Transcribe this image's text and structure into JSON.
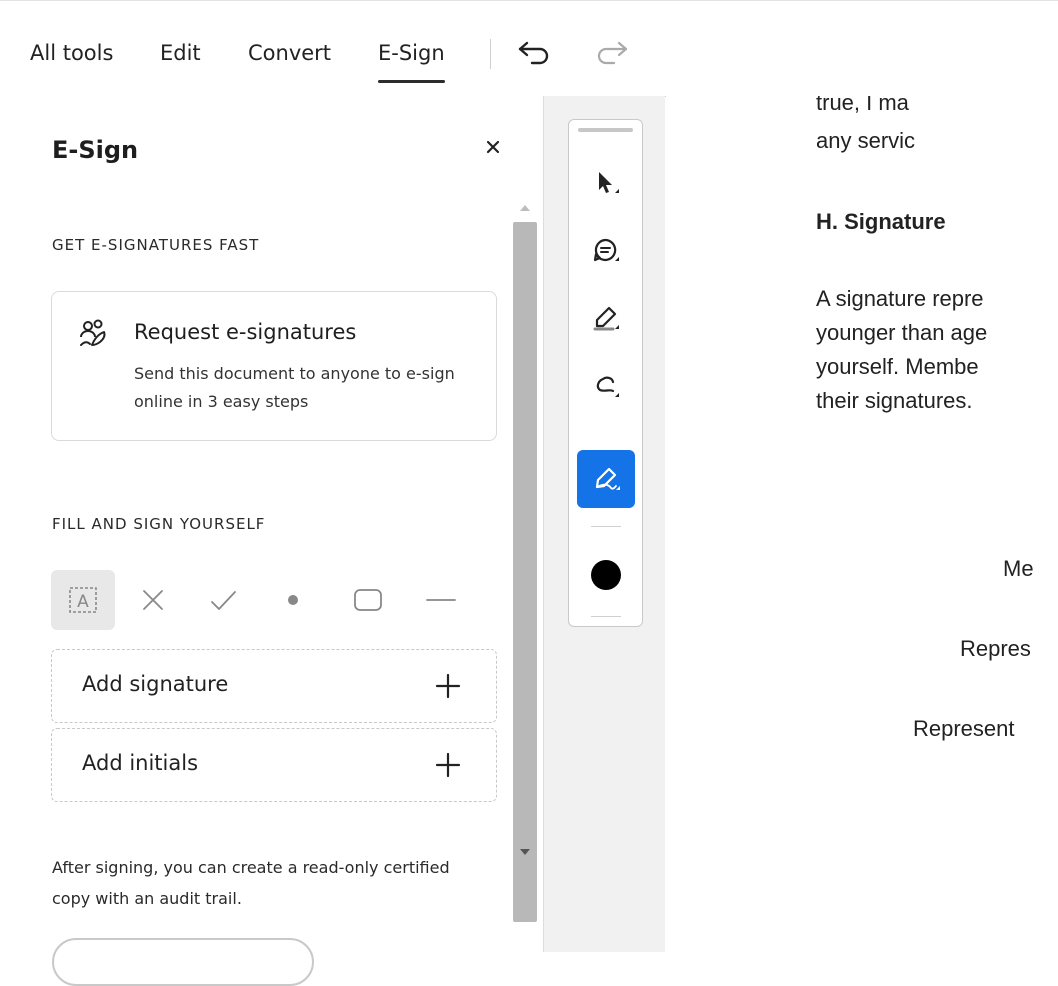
{
  "nav": {
    "tabs": [
      "All tools",
      "Edit",
      "Convert",
      "E-Sign"
    ],
    "active_tab": "E-Sign"
  },
  "panel": {
    "title": "E-Sign",
    "section1": "GET E-SIGNATURES FAST",
    "request_card": {
      "title": "Request e-signatures",
      "description": "Send this document to anyone to e-sign online in 3 easy steps"
    },
    "section2": "FILL AND SIGN YOURSELF",
    "fill_tools": [
      "text-field-icon",
      "cross-icon",
      "checkmark-icon",
      "dot-icon",
      "rectangle-icon",
      "line-icon"
    ],
    "add_signature": "Add signature",
    "add_initials": "Add initials",
    "note": "After signing, you can create a read-only certified copy with an audit trail."
  },
  "side_toolbar": {
    "tools": [
      "select-icon",
      "comment-icon",
      "highlight-icon",
      "draw-icon",
      "sign-icon"
    ],
    "active_tool": "sign-icon",
    "color": "#000000",
    "accent": "#1473e6"
  },
  "document": {
    "lines_top": [
      "true, I ma",
      "any servic"
    ],
    "heading": "H. Signature",
    "paragraph": [
      "A signature repre",
      "younger than age",
      "yourself. Membe",
      "their signatures."
    ],
    "fields": [
      "Me",
      "Repres",
      "Represent"
    ]
  }
}
